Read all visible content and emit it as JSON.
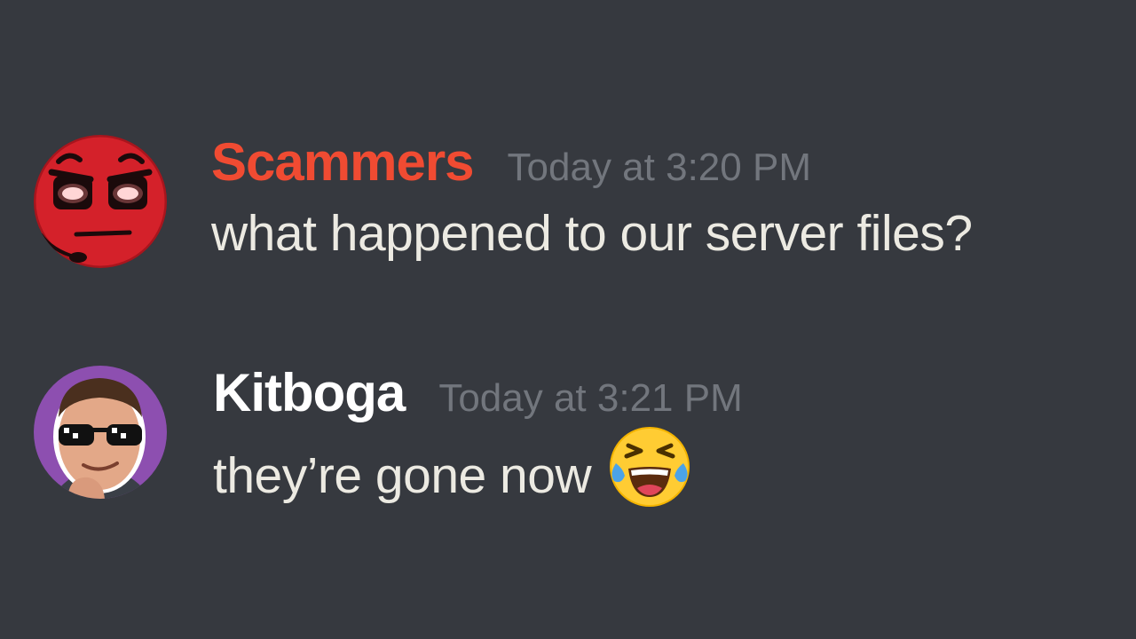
{
  "messages": [
    {
      "username": "Scammers",
      "username_color": "#f04b32",
      "timestamp": "Today at 3:20 PM",
      "text": "what happened to our server files?",
      "avatar": "red-angry-face-icon"
    },
    {
      "username": "Kitboga",
      "username_color": "#ffffff",
      "timestamp": "Today at 3:21 PM",
      "text": "they’re gone now",
      "avatar": "person-with-sunglasses-icon",
      "emoji": "laughing-tears-emoji-icon"
    }
  ],
  "colors": {
    "background": "#36393f",
    "timestamp": "#72767d",
    "message_text": "#eceae2"
  }
}
